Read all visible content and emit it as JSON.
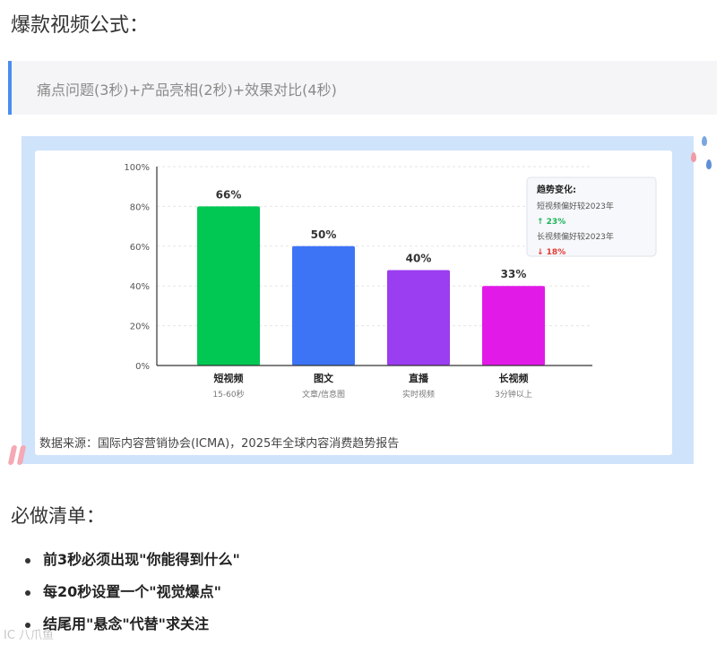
{
  "heading": "爆款视频公式：",
  "formula": "痛点问题(3秒)+产品亮相(2秒)+效果对比(4秒)",
  "chart_data": {
    "type": "bar",
    "categories": [
      "短视频",
      "图文",
      "直播",
      "长视频"
    ],
    "sublabels": [
      "15-60秒",
      "文章/信息图",
      "实时视频",
      "3分钟以上"
    ],
    "values": [
      80,
      60,
      48,
      40
    ],
    "data_labels": [
      "66%",
      "50%",
      "40%",
      "33%"
    ],
    "colors": [
      "#00c853",
      "#3d74f6",
      "#9b3df0",
      "#e21ae8"
    ],
    "yticks": [
      "0%",
      "20%",
      "40%",
      "60%",
      "80%",
      "100%"
    ],
    "ylim": [
      0,
      100
    ],
    "grid": true,
    "legend_box": {
      "title": "趋势变化:",
      "line1": "短视频偏好较2023年",
      "val1": "↑ 23%",
      "line2": "长视频偏好较2023年",
      "val2": "↓ 18%",
      "up_color": "#1fb35a",
      "down_color": "#e53935"
    }
  },
  "source": "数据来源：国际内容营销协会(ICMA)，2025年全球内容消费趋势报告",
  "checklist_heading": "必做清单：",
  "checklist": [
    "前3秒必须出现\"你能得到什么\"",
    "每20秒设置一个\"视觉爆点\"",
    "结尾用\"悬念\"代替\"求关注"
  ],
  "watermark": "IC 八爪鱼"
}
